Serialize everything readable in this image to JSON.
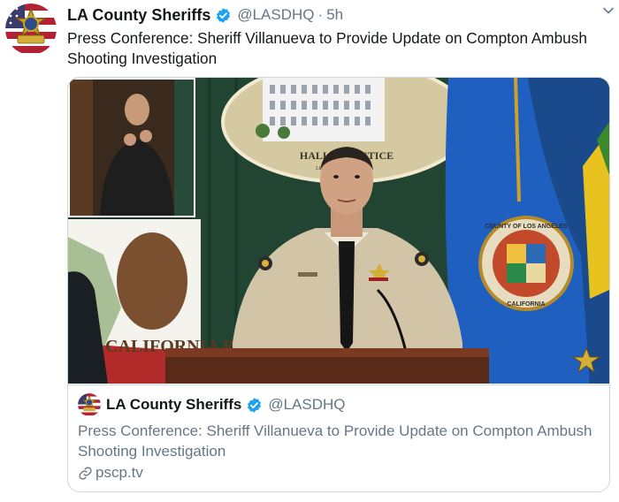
{
  "tweet": {
    "author_name": "LA County Sheriffs",
    "handle": "@LASDHQ",
    "separator": "·",
    "time": "5h",
    "text": "Press Conference: Sheriff Villanueva to Provide Update on Compton Ambush Shooting Investigation"
  },
  "media": {
    "seal_text_top": "HALL OF JUSTICE",
    "seal_text_bottom": "LOS ANGELES",
    "county_seal_text": "COUNTY OF LOS ANGELES",
    "county_seal_text_bottom": "CALIFORNIA",
    "flag_text": "CALIFORNIA R"
  },
  "card": {
    "author_name": "LA County Sheriffs",
    "handle": "@LASDHQ",
    "description": "Press Conference: Sheriff Villanueva to Provide Update on Compton Ambush Shooting Investigation",
    "link": "pscp.tv"
  },
  "colors": {
    "verified": "#1da1f2",
    "muted_text": "#657786",
    "border": "#ccd6dd"
  },
  "icons": {
    "verified": "verified-badge-icon",
    "menu": "chevron-down-icon",
    "link": "link-icon"
  }
}
